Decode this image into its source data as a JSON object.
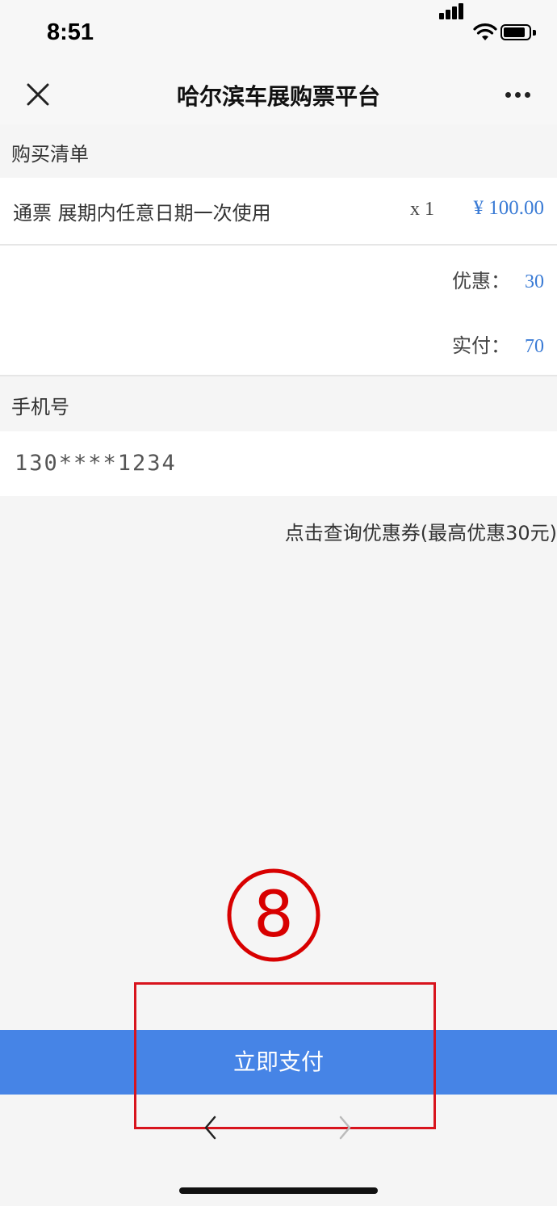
{
  "status_bar": {
    "time": "8:51",
    "icons": [
      "cellular-signal-icon",
      "wifi-icon",
      "battery-icon"
    ]
  },
  "nav": {
    "title": "哈尔滨车展购票平台",
    "close_icon": "close-icon",
    "more_icon": "more-icon"
  },
  "order": {
    "section_title": "购买清单",
    "item": {
      "name": "通票 展期内任意日期一次使用",
      "quantity": "x 1",
      "price": "¥ 100.00"
    },
    "discount": {
      "label": "优惠：",
      "value": "30"
    },
    "paid": {
      "label": "实付：",
      "value": "70"
    }
  },
  "phone": {
    "section_title": "手机号",
    "value": "130****1234"
  },
  "coupon_link": "点击查询优惠券(最高优惠30元)",
  "annotation": {
    "step_number": "8"
  },
  "pay_button": "立即支付",
  "browser_nav": {
    "back_icon": "chevron-left-icon",
    "forward_icon": "chevron-right-icon"
  },
  "colors": {
    "accent_blue": "#4684e6",
    "value_blue": "#3a7bd5",
    "annotation_red": "#d8141d"
  }
}
